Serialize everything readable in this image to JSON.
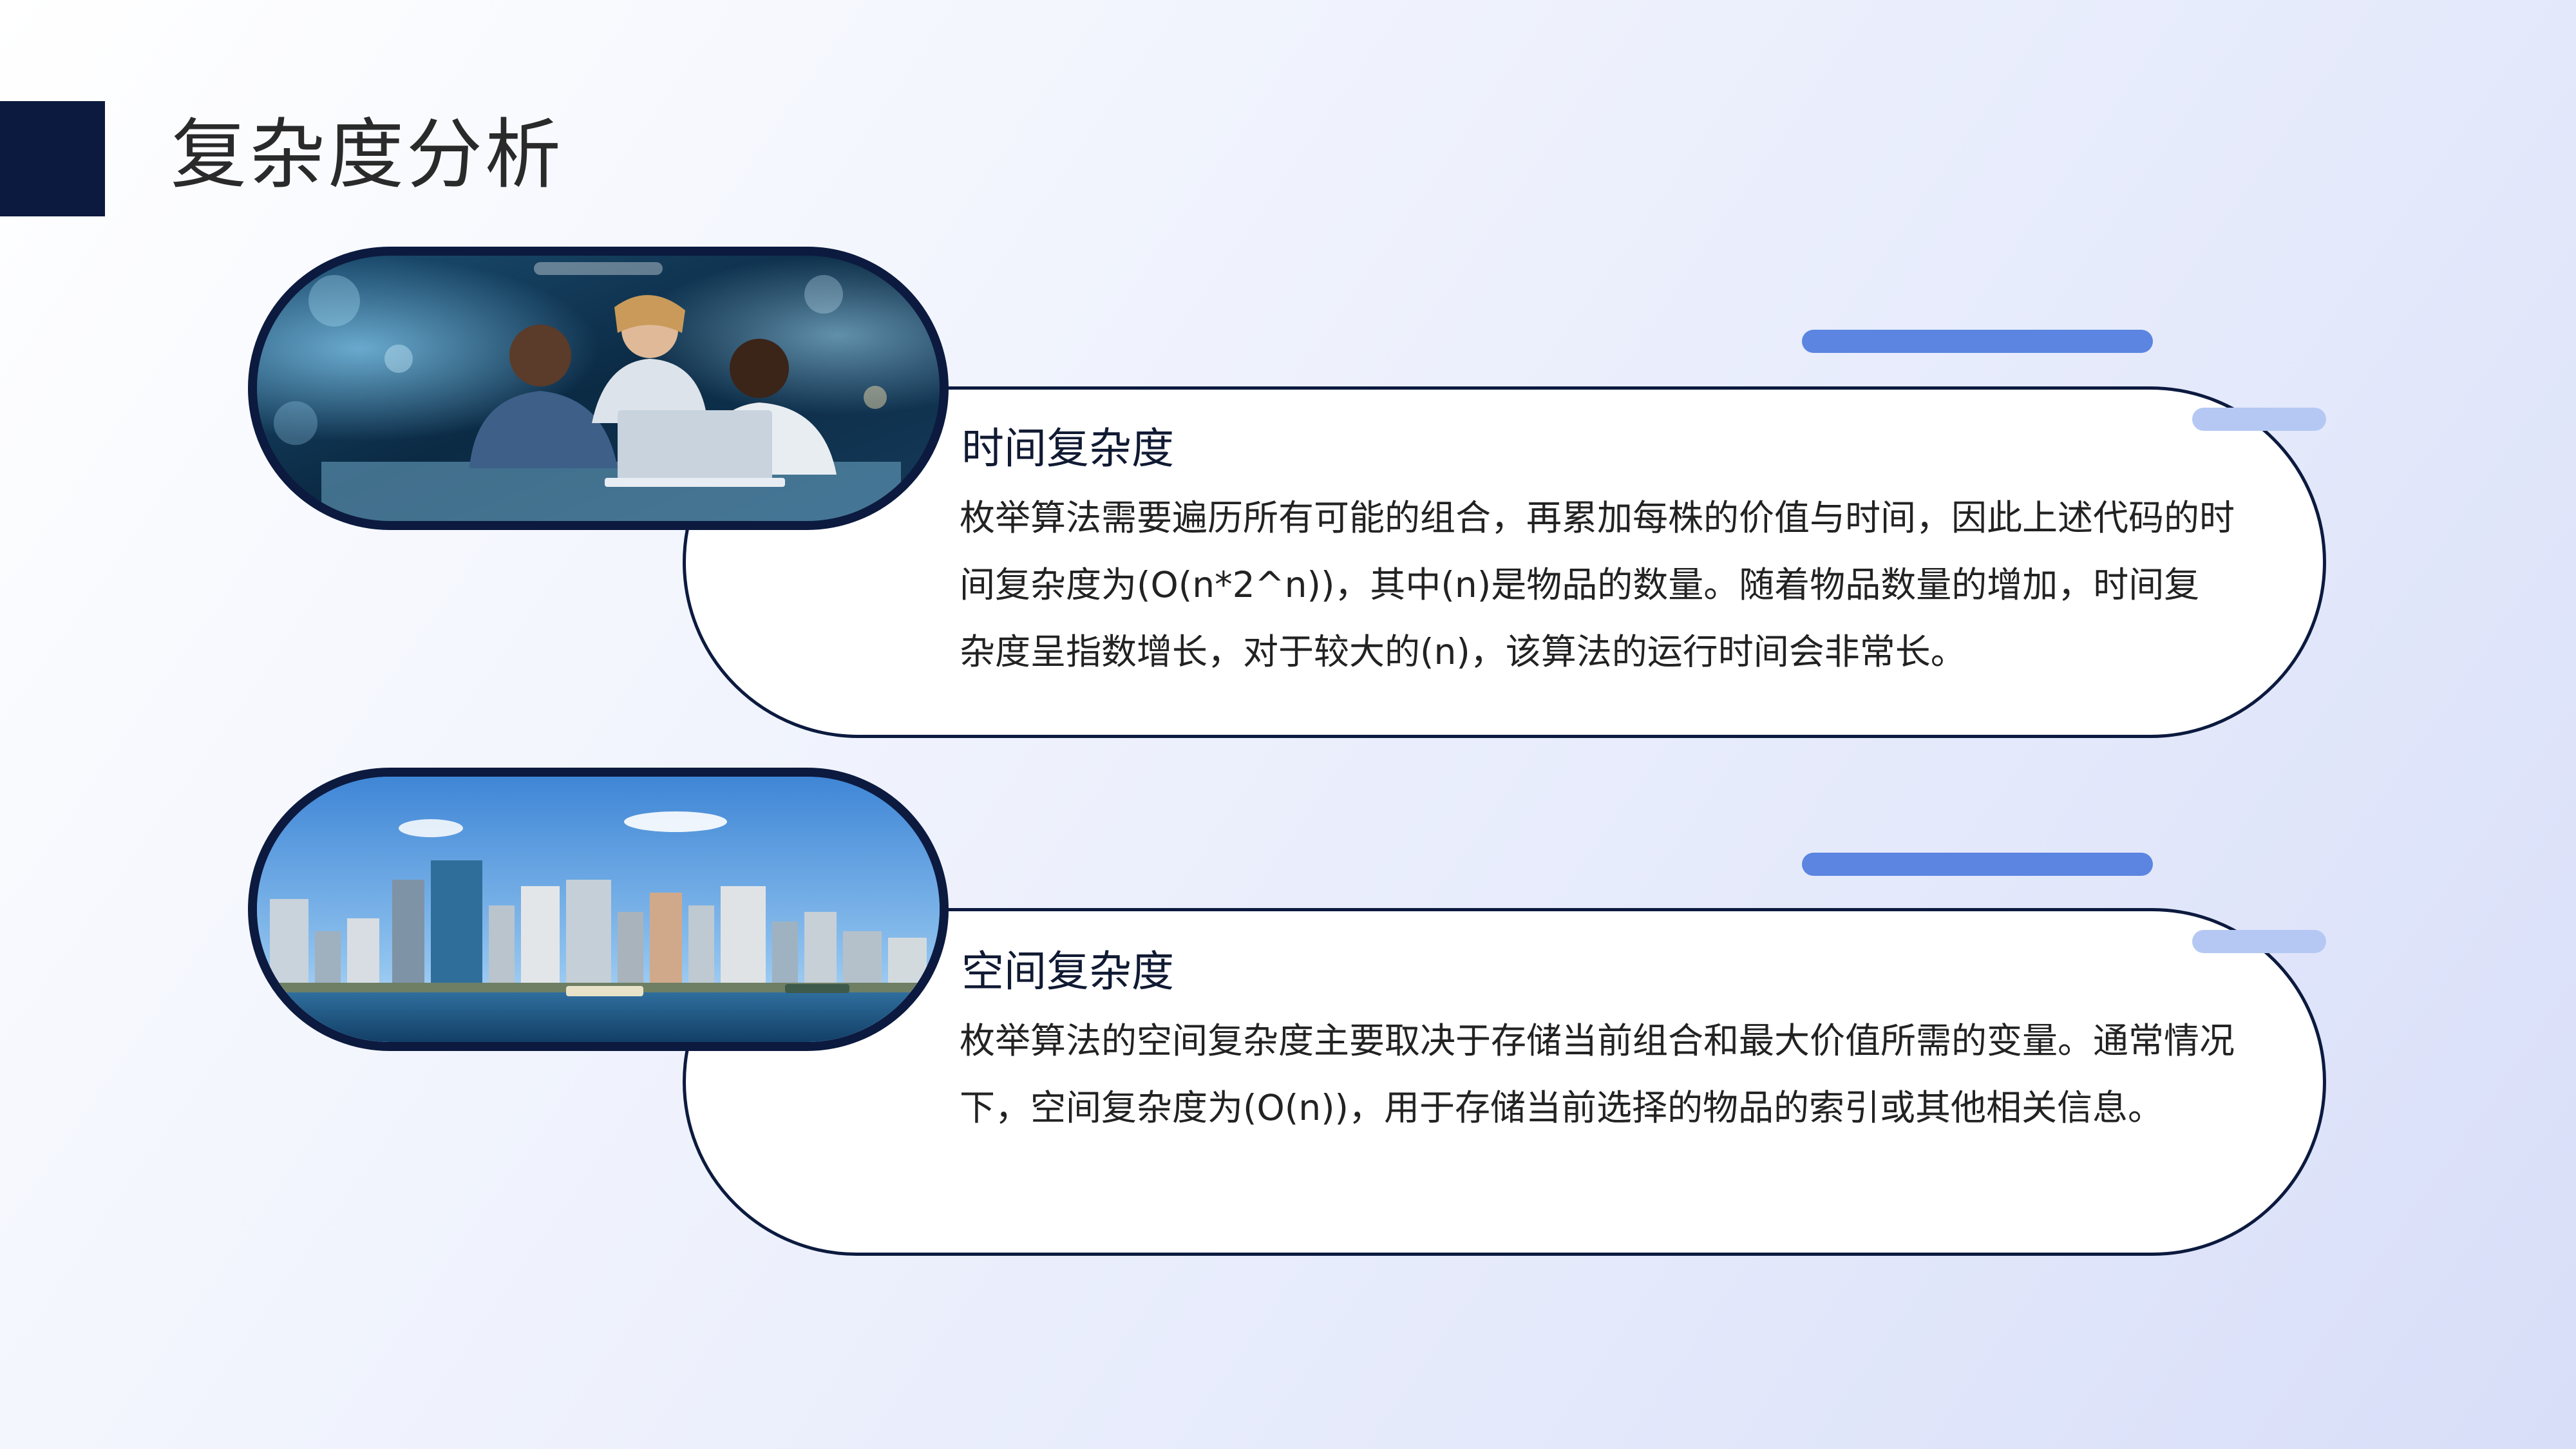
{
  "slide": {
    "title": "复杂度分析"
  },
  "sections": [
    {
      "title": "时间复杂度",
      "body": "枚举算法需要遍历所有可能的组合，再累加每株的价值与时间，因此上述代码的时间复杂度为(O(n*2^n))，其中(n)是物品的数量。随着物品数量的增加，时间复杂度呈指数增长，对于较大的(n)，该算法的运行时间会非常长。",
      "image": "team-working-at-laptop-photo"
    },
    {
      "title": "空间复杂度",
      "body": "枚举算法的空间复杂度主要取决于存储当前组合和最大价值所需的变量。通常情况下，空间复杂度为(O(n))，用于存储当前选择的物品的索引或其他相关信息。",
      "image": "city-skyline-waterfront-photo"
    }
  ],
  "colors": {
    "navy": "#0c1a3f",
    "accent_blue": "#5b85e0",
    "accent_light": "#b4c8f3",
    "card_bg": "#ffffff"
  }
}
